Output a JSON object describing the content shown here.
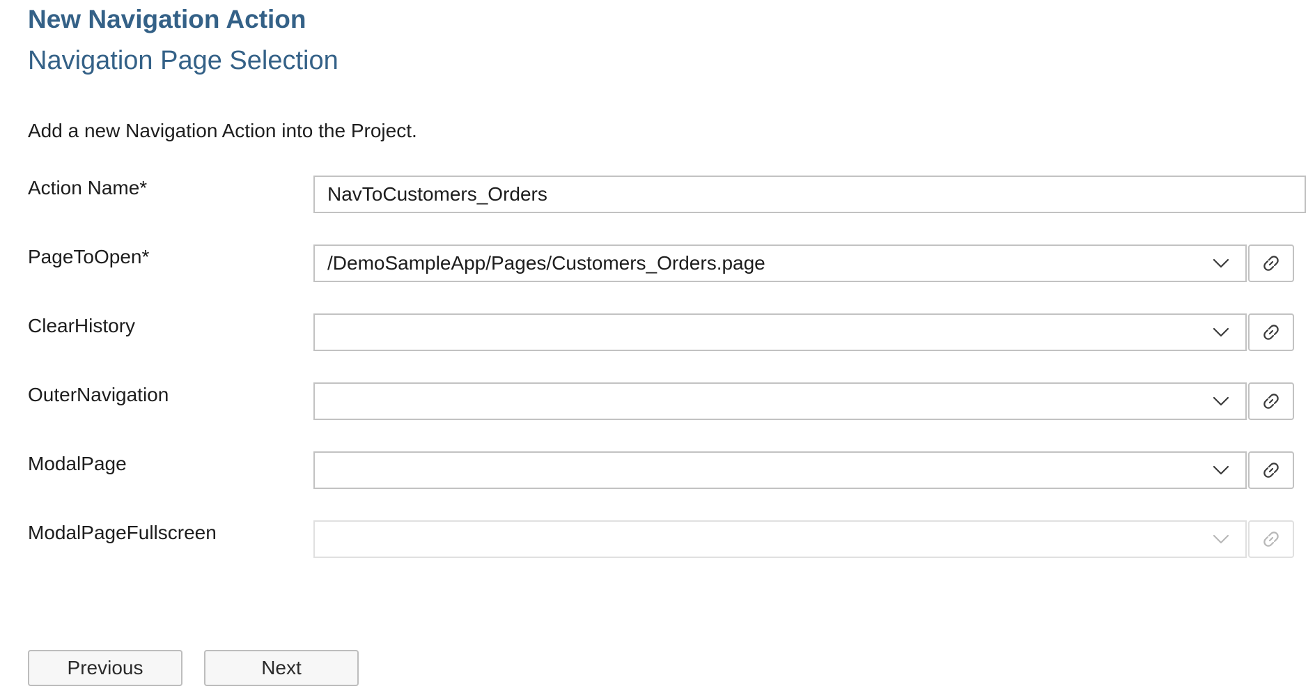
{
  "header": {
    "wizard_title": "New Navigation Action",
    "step_title": "Navigation Page Selection"
  },
  "description": "Add a new Navigation Action into the Project.",
  "form": {
    "action_name": {
      "label": "Action Name*",
      "value": "NavToCustomers_Orders"
    },
    "page_to_open": {
      "label": "PageToOpen*",
      "value": "/DemoSampleApp/Pages/Customers_Orders.page"
    },
    "clear_history": {
      "label": "ClearHistory",
      "value": ""
    },
    "outer_navigation": {
      "label": "OuterNavigation",
      "value": ""
    },
    "modal_page": {
      "label": "ModalPage",
      "value": ""
    },
    "modal_page_fullscreen": {
      "label": "ModalPageFullscreen",
      "value": "",
      "disabled": true
    }
  },
  "buttons": {
    "previous": "Previous",
    "next": "Next"
  },
  "icons": {
    "dropdown": "chevron-down-icon",
    "binding": "link-icon"
  },
  "colors": {
    "title": "#346187",
    "border": "#c2c2c2",
    "disabled_border": "#e0e0e0"
  }
}
